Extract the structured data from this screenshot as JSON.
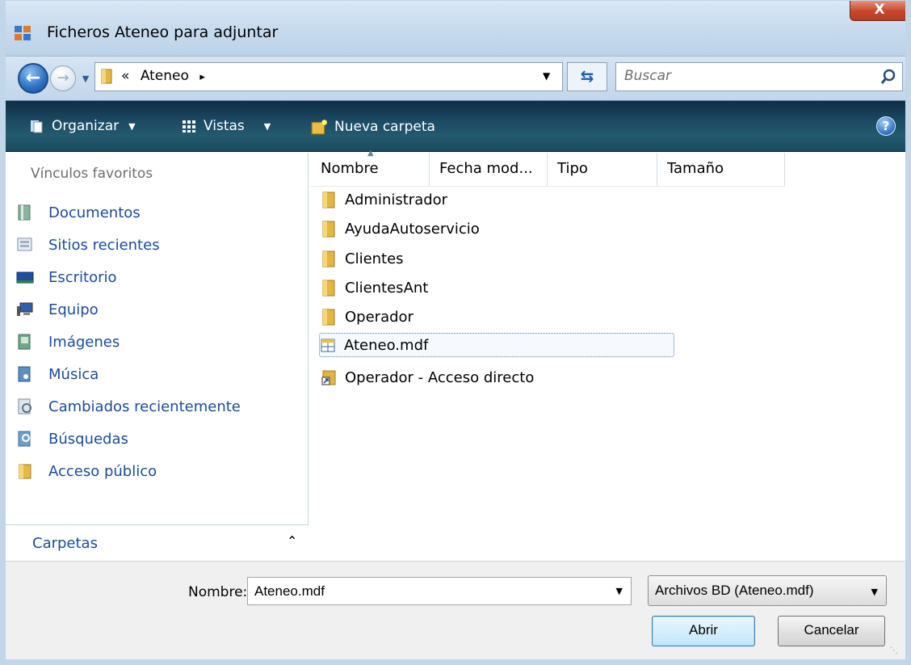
{
  "window": {
    "title": "Ficheros Ateneo para adjuntar",
    "close_label": "X"
  },
  "address": {
    "path_prefix": "«",
    "path": "Ateneo",
    "path_sep": "▸",
    "search_placeholder": "Buscar"
  },
  "toolbar": {
    "organize_label": "Organizar",
    "views_label": "Vistas",
    "new_folder_label": "Nueva carpeta",
    "help_label": "?"
  },
  "sidebar": {
    "heading": "Vínculos favoritos",
    "items": [
      {
        "label": "Documentos",
        "icon": "documents-icon"
      },
      {
        "label": "Sitios recientes",
        "icon": "recent-places-icon"
      },
      {
        "label": "Escritorio",
        "icon": "desktop-icon"
      },
      {
        "label": "Equipo",
        "icon": "computer-icon"
      },
      {
        "label": "Imágenes",
        "icon": "pictures-icon"
      },
      {
        "label": "Música",
        "icon": "music-icon"
      },
      {
        "label": "Cambiados recientemente",
        "icon": "recently-changed-icon"
      },
      {
        "label": "Búsquedas",
        "icon": "searches-icon"
      },
      {
        "label": "Acceso público",
        "icon": "public-folder-icon"
      }
    ],
    "folders_label": "Carpetas",
    "folders_chevron": "⌃"
  },
  "file_list": {
    "columns": [
      "Nombre",
      "Fecha mod...",
      "Tipo",
      "Tamaño"
    ],
    "files": [
      {
        "name": "Administrador",
        "icon": "folder-icon"
      },
      {
        "name": "AyudaAutoservicio",
        "icon": "folder-icon"
      },
      {
        "name": "Clientes",
        "icon": "folder-icon"
      },
      {
        "name": "ClientesAnt",
        "icon": "folder-icon"
      },
      {
        "name": "Operador",
        "icon": "folder-icon"
      },
      {
        "name": "Ateneo.mdf",
        "icon": "database-file-icon",
        "selected": true
      },
      {
        "name": "Operador - Acceso directo",
        "icon": "shortcut-icon"
      }
    ]
  },
  "footer": {
    "name_label": "Nombre:",
    "name_value": "Ateneo.mdf",
    "file_type": "Archivos BD (Ateneo.mdf)",
    "open_label": "Abrir",
    "cancel_label": "Cancelar"
  },
  "colors": {
    "link_blue": "#1a4b9d",
    "command_bar": "#1c4a63",
    "close_red": "#c9462c"
  }
}
